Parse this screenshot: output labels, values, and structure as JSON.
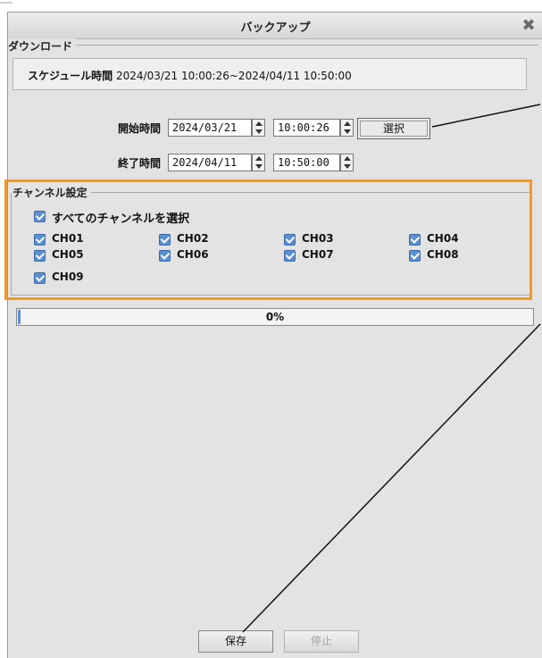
{
  "window": {
    "title": "バックアップ",
    "close_icon": "close-x-icon"
  },
  "download_group": {
    "label": "ダウンロード"
  },
  "schedule": {
    "label": "スケジュール時間",
    "range": "2024/03/21 10:00:26~2024/04/11 10:50:00"
  },
  "start": {
    "label": "開始時間",
    "date": "2024/03/21",
    "time": "10:00:26"
  },
  "end": {
    "label": "終了時間",
    "date": "2024/04/11",
    "time": "10:50:00"
  },
  "select_button": {
    "label": "選択"
  },
  "channels": {
    "label": "チャンネル設定",
    "select_all": {
      "label": "すべてのチャンネルを選択",
      "checked": true
    },
    "items": [
      {
        "label": "CH01",
        "checked": true
      },
      {
        "label": "CH02",
        "checked": true
      },
      {
        "label": "CH03",
        "checked": true
      },
      {
        "label": "CH04",
        "checked": true
      },
      {
        "label": "CH05",
        "checked": true
      },
      {
        "label": "CH06",
        "checked": true
      },
      {
        "label": "CH07",
        "checked": true
      },
      {
        "label": "CH08",
        "checked": true
      },
      {
        "label": "CH09",
        "checked": true
      }
    ]
  },
  "progress": {
    "text": "0%",
    "value": 0
  },
  "buttons": {
    "save": "保存",
    "stop": "停止"
  },
  "colors": {
    "highlight": "#f39a22",
    "checkbox": "#5b8fd0"
  }
}
